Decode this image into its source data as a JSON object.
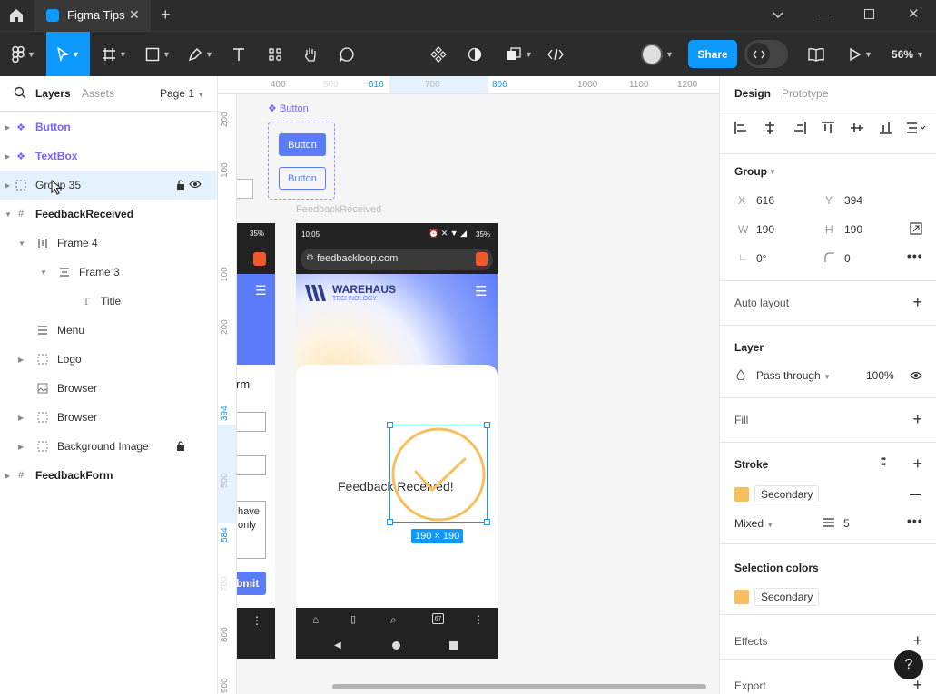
{
  "tab": {
    "title": "Figma Tips"
  },
  "toolbar": {
    "share_label": "Share",
    "zoom": "56%"
  },
  "left_panel": {
    "tabs": [
      "Layers",
      "Assets"
    ],
    "page": "Page 1",
    "layers": [
      {
        "name": "Button"
      },
      {
        "name": "TextBox"
      },
      {
        "name": "Group 35"
      },
      {
        "name": "FeedbackReceived"
      },
      {
        "name": "Frame 4"
      },
      {
        "name": "Frame 3"
      },
      {
        "name": "Title"
      },
      {
        "name": "Menu"
      },
      {
        "name": "Logo"
      },
      {
        "name": "Browser"
      },
      {
        "name": "Browser"
      },
      {
        "name": "Background Image"
      },
      {
        "name": "FeedbackForm"
      }
    ]
  },
  "rulers": {
    "top": [
      "400",
      "500",
      "616",
      "700",
      "806",
      "1000",
      "1100",
      "1200"
    ],
    "left": [
      "200",
      "100",
      "100",
      "200",
      "394",
      "500",
      "584",
      "700",
      "800",
      "900"
    ]
  },
  "canvas": {
    "component_label": "Button",
    "button_primary": "Button",
    "button_secondary": "Button",
    "frame_label": "FeedbackReceived",
    "status_time": "10:05",
    "battery": "35%",
    "battery_left": "35%",
    "url": "feedbackloop.com",
    "logo_title": "WAREHAUS",
    "logo_sub": "TECHNOLOGY",
    "feedback_text": "Feedback Received!",
    "size_badge": "190 × 190",
    "tabs_count": "67",
    "form_title_fragment": "rm",
    "form_text_1": "have",
    "form_text_2": "only",
    "submit_fragment": "bmit"
  },
  "right_panel": {
    "tabs": [
      "Design",
      "Prototype"
    ],
    "group": {
      "title": "Group",
      "x_label": "X",
      "x": "616",
      "y_label": "Y",
      "y": "394",
      "w_label": "W",
      "w": "190",
      "h_label": "H",
      "h": "190",
      "rotation": "0°",
      "radius": "0"
    },
    "auto_layout": "Auto layout",
    "layer": {
      "title": "Layer",
      "blend": "Pass through",
      "opacity": "100%"
    },
    "fill": "Fill",
    "stroke": {
      "title": "Stroke",
      "style": "Secondary",
      "mode": "Mixed",
      "weight": "5"
    },
    "selection_colors": {
      "title": "Selection colors",
      "style": "Secondary"
    },
    "effects": "Effects",
    "export": "Export"
  },
  "colors": {
    "accent": "#0d99ff",
    "component": "#7b61ff",
    "secondary": "#f8bf5e",
    "brand_blue": "#5b7cfa",
    "selection": "#0d99ff"
  },
  "icons": [
    "home-icon",
    "figma-tab-icon",
    "close-icon",
    "plus-icon",
    "minimize-icon",
    "maximize-icon",
    "figma-menu-icon",
    "move-tool-icon",
    "frame-tool-icon",
    "shape-tool-icon",
    "pen-tool-icon",
    "text-tool-icon",
    "resources-icon",
    "hand-tool-icon",
    "comment-icon",
    "components-icon",
    "mask-icon",
    "boolean-icon",
    "code-icon",
    "library-icon",
    "play-icon",
    "search-icon",
    "lock-icon",
    "eye-icon",
    "help-icon"
  ]
}
